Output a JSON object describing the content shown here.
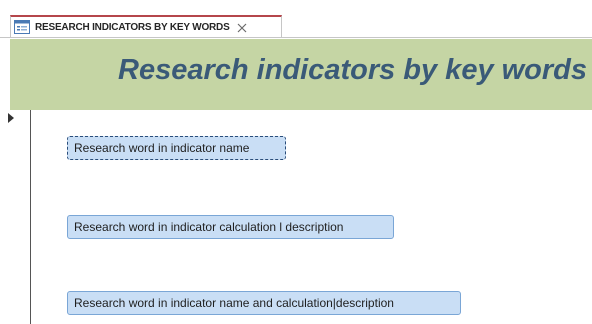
{
  "tab": {
    "label": "RESEARCH INDICATORS BY KEY WORDS",
    "icon": "form-icon",
    "close_icon": "close-icon",
    "accent_color": "#b5464b"
  },
  "header": {
    "title": "Research indicators by key words",
    "band_color": "#c5d5a4",
    "title_color": "#3a5a78"
  },
  "record_selector": {
    "icon": "current-record-arrow-icon"
  },
  "buttons": [
    {
      "label": "Research word in indicator name",
      "focused": true
    },
    {
      "label": "Research word in indicator calculation l description",
      "focused": false
    },
    {
      "label": "Research word in indicator name and calculation|description",
      "focused": false
    }
  ],
  "colors": {
    "button_fill": "#c9def5",
    "button_border": "#7aa6d6"
  }
}
